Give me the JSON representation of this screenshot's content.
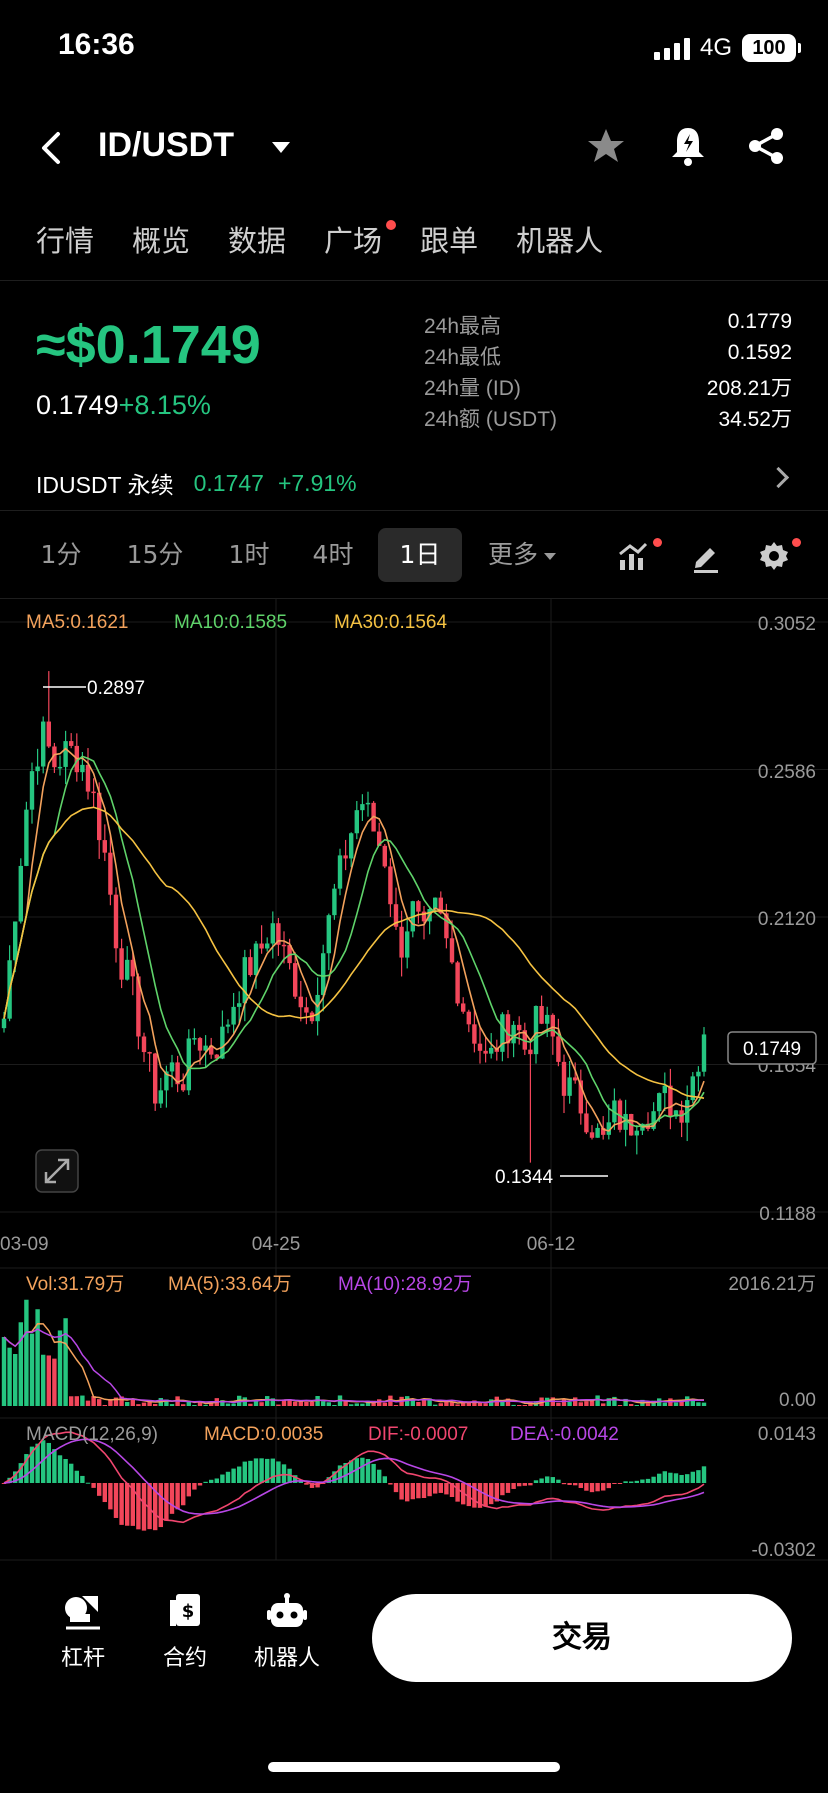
{
  "status_bar": {
    "time": "16:36",
    "network": "4G",
    "battery": "100"
  },
  "header": {
    "pair": "ID/USDT"
  },
  "tabs": [
    {
      "label": "行情",
      "dot": false
    },
    {
      "label": "概览",
      "dot": false
    },
    {
      "label": "数据",
      "dot": false
    },
    {
      "label": "广场",
      "dot": true
    },
    {
      "label": "跟单",
      "dot": false
    },
    {
      "label": "机器人",
      "dot": false
    }
  ],
  "price": {
    "approx": "≈$0.1749",
    "last": "0.1749",
    "change": "+8.15%"
  },
  "stats": [
    {
      "label": "24h最高",
      "value": "0.1779"
    },
    {
      "label": "24h最低",
      "value": "0.1592"
    },
    {
      "label": "24h量 (ID)",
      "value": "208.21万"
    },
    {
      "label": "24h额 (USDT)",
      "value": "34.52万"
    }
  ],
  "perpetual": {
    "name": "IDUSDT 永续",
    "price": "0.1747",
    "change": "+7.91%"
  },
  "timeframes": [
    {
      "label": "1分",
      "active": false
    },
    {
      "label": "15分",
      "active": false
    },
    {
      "label": "1时",
      "active": false
    },
    {
      "label": "4时",
      "active": false
    },
    {
      "label": "1日",
      "active": true
    }
  ],
  "more_label": "更多",
  "colors": {
    "up": "#25c580",
    "down": "#f2465a",
    "ma5": "#f3a25c",
    "ma10": "#5fd36a",
    "ma30": "#f5c242",
    "macd": "#f3a25c",
    "dif": "#f0466f",
    "dea": "#b847e6"
  },
  "indicators": {
    "ma5": "MA5:0.1621",
    "ma10": "MA10:0.1585",
    "ma30": "MA30:0.1564",
    "vol": "Vol:31.79万",
    "vol_ma5": "MA(5):33.64万",
    "vol_ma10": "MA(10):28.92万",
    "macd_title": "MACD(12,26,9)",
    "macd": "MACD:0.0035",
    "dif": "DIF:-0.0007",
    "dea": "DEA:-0.0042"
  },
  "chart_data": {
    "type": "candlestick",
    "y_ticks": [
      "0.3052",
      "0.2586",
      "0.2120",
      "0.1654",
      "0.1188"
    ],
    "ylim": [
      0.1188,
      0.3052
    ],
    "x_ticks": [
      "03-09",
      "04-25",
      "06-12"
    ],
    "last_price_label": "0.1749",
    "high_label": "0.2897",
    "low_label": "0.1344",
    "high": 0.2897,
    "low": 0.1344,
    "close_path": [
      0.18,
      0.22,
      0.255,
      0.27,
      0.26,
      0.265,
      0.262,
      0.25,
      0.23,
      0.2,
      0.19,
      0.17,
      0.155,
      0.165,
      0.16,
      0.175,
      0.17,
      0.172,
      0.185,
      0.195,
      0.2,
      0.21,
      0.2,
      0.19,
      0.18,
      0.2,
      0.22,
      0.235,
      0.25,
      0.24,
      0.23,
      0.2,
      0.215,
      0.205,
      0.215,
      0.2,
      0.185,
      0.175,
      0.165,
      0.175,
      0.18,
      0.17,
      0.18,
      0.175,
      0.16,
      0.155,
      0.148,
      0.14,
      0.15,
      0.145,
      0.152,
      0.15,
      0.155,
      0.15,
      0.16,
      0.1749
    ],
    "volume_axis": [
      "2016.21万",
      "0.00"
    ],
    "macd_axis": [
      "0.0143",
      "-0.0302"
    ]
  },
  "bottom_nav": [
    {
      "label": "杠杆",
      "icon": "leverage-icon"
    },
    {
      "label": "合约",
      "icon": "contract-icon"
    },
    {
      "label": "机器人",
      "icon": "robot-icon"
    }
  ],
  "trade_button": "交易"
}
